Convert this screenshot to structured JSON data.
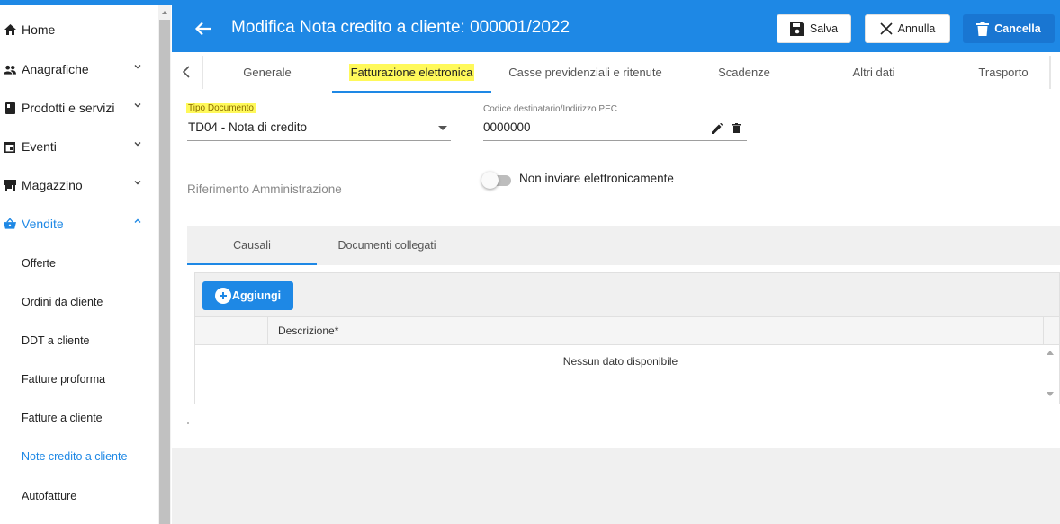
{
  "sidebar": {
    "items": [
      {
        "label": "Home",
        "icon": "home-icon"
      },
      {
        "label": "Anagrafiche",
        "icon": "people-icon"
      },
      {
        "label": "Prodotti e servizi",
        "icon": "book-icon"
      },
      {
        "label": "Eventi",
        "icon": "calendar-icon"
      },
      {
        "label": "Magazzino",
        "icon": "store-icon"
      },
      {
        "label": "Vendite",
        "icon": "basket-icon"
      }
    ],
    "vendite_subitems": [
      "Offerte",
      "Ordini da cliente",
      "DDT a cliente",
      "Fatture proforma",
      "Fatture a cliente",
      "Note credito a cliente",
      "Autofatture"
    ]
  },
  "header": {
    "title": "Modifica Nota credito a cliente: 000001/2022",
    "save_label": "Salva",
    "cancel_label": "Annulla",
    "delete_label": "Cancella"
  },
  "tabs": [
    "Generale",
    "Fatturazione elettronica",
    "Casse previdenziali e ritenute",
    "Scadenze",
    "Altri dati",
    "Trasporto"
  ],
  "active_tab": "Fatturazione elettronica",
  "form": {
    "tipo_documento_label": "Tipo Documento",
    "tipo_documento_value": "TD04 - Nota di credito",
    "codice_destinatario_label": "Codice destinatario/Indirizzo PEC",
    "codice_destinatario_value": "0000000",
    "riferimento_placeholder": "Riferimento Amministrazione",
    "non_inviare_label": "Non inviare elettronicamente"
  },
  "subtabs": [
    "Causali",
    "Documenti collegati"
  ],
  "grid": {
    "add_label": "Aggiungi",
    "column_descrizione": "Descrizione*",
    "no_data": "Nessun dato disponibile"
  },
  "colors": {
    "primary": "#1e88e5",
    "highlight": "#fff95a"
  }
}
